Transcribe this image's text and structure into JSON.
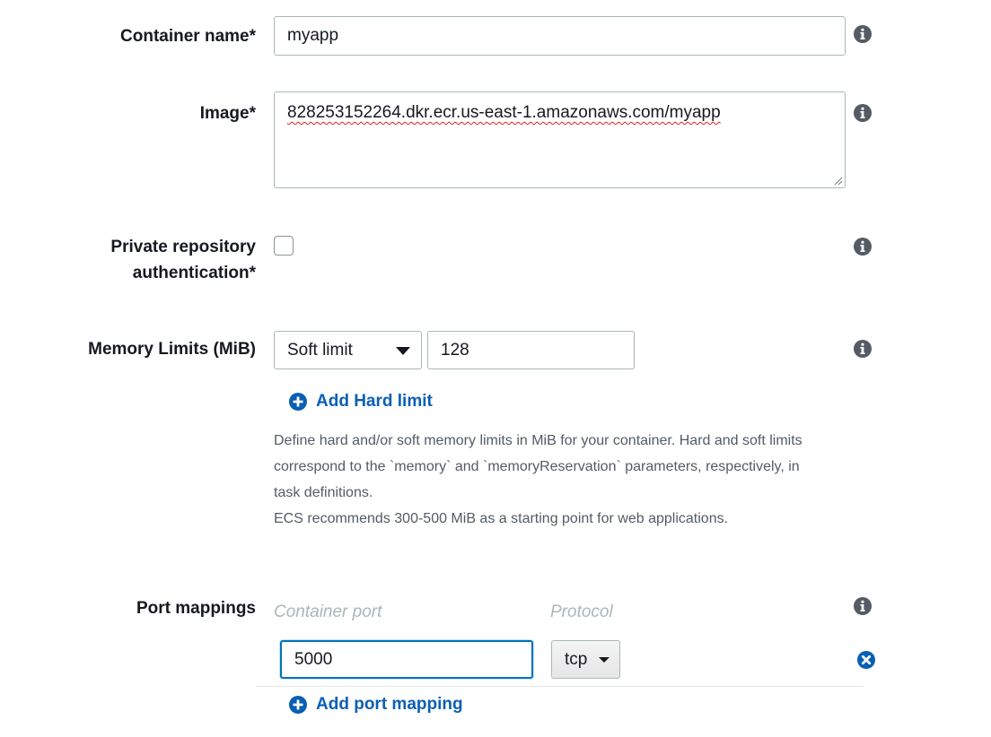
{
  "container_name": {
    "label": "Container name*",
    "value": "myapp"
  },
  "image": {
    "label": "Image*",
    "value": "828253152264.dkr.ecr.us-east-1.amazonaws.com/myapp"
  },
  "private_repo": {
    "label_line1": "Private repository",
    "label_line2": "authentication*",
    "checked": false
  },
  "memory": {
    "label": "Memory Limits (MiB)",
    "limit_type": "Soft limit",
    "value": "128",
    "add_link": "Add Hard limit",
    "help_line1": "Define hard and/or soft memory limits in MiB for your container. Hard and soft limits",
    "help_line2": "correspond to the `memory` and `memoryReservation` parameters, respectively, in",
    "help_line3": "task definitions.",
    "help_line4": "ECS recommends 300-500 MiB as a starting point for web applications."
  },
  "ports": {
    "label": "Port mappings",
    "col_container_port": "Container port",
    "col_protocol": "Protocol",
    "container_port_value": "5000",
    "protocol_value": "tcp",
    "add_link": "Add port mapping"
  },
  "colors": {
    "link": "#0a5fb4",
    "focus": "#0073bb",
    "icon": "#545b64"
  },
  "icons": {
    "info": "info-icon",
    "add": "plus-circle-icon",
    "remove": "close-circle-icon"
  }
}
